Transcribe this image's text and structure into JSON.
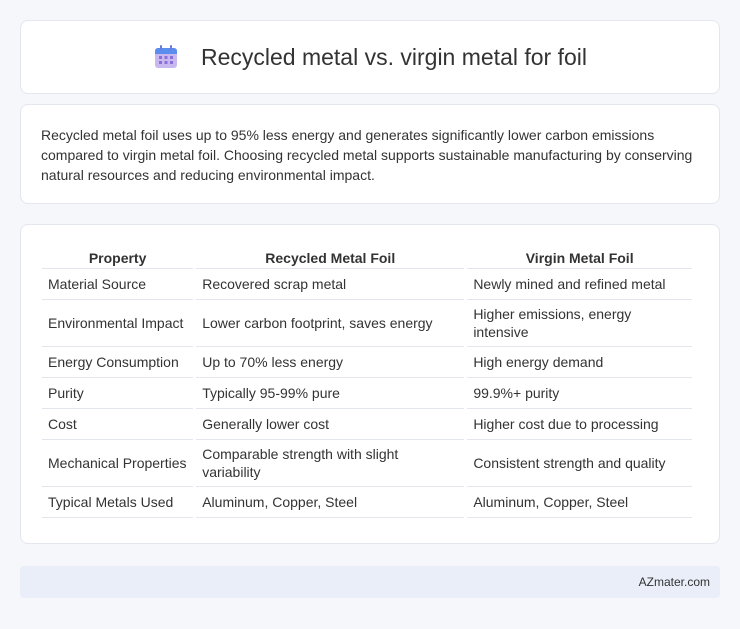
{
  "header": {
    "title": "Recycled metal vs. virgin metal for foil",
    "icon": "calendar-icon"
  },
  "summary": {
    "text": "Recycled metal foil uses up to 95% less energy and generates significantly lower carbon emissions compared to virgin metal foil. Choosing recycled metal supports sustainable manufacturing by conserving natural resources and reducing environmental impact."
  },
  "table": {
    "headers": [
      "Property",
      "Recycled Metal Foil",
      "Virgin Metal Foil"
    ],
    "rows": [
      [
        "Material Source",
        "Recovered scrap metal",
        "Newly mined and refined metal"
      ],
      [
        "Environmental Impact",
        "Lower carbon footprint, saves energy",
        "Higher emissions, energy intensive"
      ],
      [
        "Energy Consumption",
        "Up to 70% less energy",
        "High energy demand"
      ],
      [
        "Purity",
        "Typically 95-99% pure",
        "99.9%+ purity"
      ],
      [
        "Cost",
        "Generally lower cost",
        "Higher cost due to processing"
      ],
      [
        "Mechanical Properties",
        "Comparable strength with slight variability",
        "Consistent strength and quality"
      ],
      [
        "Typical Metals Used",
        "Aluminum, Copper, Steel",
        "Aluminum, Copper, Steel"
      ]
    ]
  },
  "footer": {
    "brand": "AZmater.com"
  },
  "colors": {
    "icon_top": "#5b8def",
    "icon_body": "#c9b8f0",
    "icon_dots": "#8a6fd6"
  }
}
